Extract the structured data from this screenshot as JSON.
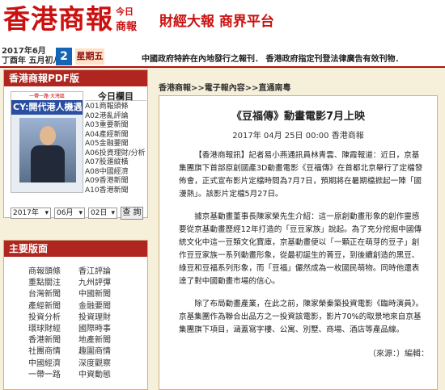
{
  "header": {
    "logo": "香港商報",
    "logo_sub_top": "今日",
    "logo_sub_bottom": "商報",
    "slogan": "財經大報 商界平台"
  },
  "datebar": {
    "date_line1": "2017年6月",
    "date_line2": "丁酉年 五月初八",
    "day": "2",
    "weekday": "星期五",
    "ticker": "中國政府特許在內地發行之報刊． 香港政府指定刊登法律廣告有效刊物．"
  },
  "pdf": {
    "heading": "香港商報PDF版",
    "thumb_bar": "一帶一路‧大灣區",
    "thumb_caption": "CY:開代港人機遇",
    "list_title": "今日欄目",
    "items": [
      "A01商報頭條",
      "A02港亂評論",
      "A03重要新聞",
      "A04產經新聞",
      "A05金融要聞",
      "A06投資理財/分析",
      "A07股滙縱橫",
      "A08中國經濟",
      "A09香港新聞",
      "A10香港新聞"
    ],
    "year": "2017年",
    "month": "06月",
    "day": "02日",
    "query_label": "查 詢"
  },
  "sections": {
    "heading": "主要版面",
    "rows": [
      [
        "商報頭條",
        "香江評論"
      ],
      [
        "重點關注",
        "九州評彈"
      ],
      [
        "台灣新聞",
        "中國新聞"
      ],
      [
        "產經新聞",
        "金融要聞"
      ],
      [
        "投資分析",
        "投資理財"
      ],
      [
        "環球財經",
        "國際時事"
      ],
      [
        "香港新聞",
        "地產新聞"
      ],
      [
        "社團商情",
        "趣圍商情"
      ],
      [
        "中國經濟",
        "深度觀察"
      ],
      [
        "一帶一路",
        "中資動態"
      ]
    ]
  },
  "breadcrumb": "香港商報>>電子報內容>>直通南粵",
  "article": {
    "title": "《豆福傳》動畫電影7月上映",
    "meta": "2017年 04月 25日 00:00 香港商報",
    "paragraphs": [
      "【香港商報訊】記者易小燕通訊員林青雲、陳霞報道：近日，京基集團旗下首部原創國產3D動畫電影《豆福傳》在首都北京舉行了定檔發佈會，正式宣布影片定檔時間為7月7日，預期將在暑期檔掀起一陣「國漫熱」。該影片定檔5月27日。",
      "據京基動畫董事長陳家榮先生介紹：這一原創動畫形象的創作靈感要從京基動畫歷經12年打造的「豆豆家族」說起。為了充分挖掘中國傳統文化中這一豆類文化寶庫，京基動畫便以「一顆正在萌芽的豆子」創作豆豆家族一系列動畫形象，從最初誕生的菁豆，到後續創造的黑豆、綠豆和豆福系列形象，而「豆福」儼然成為一枚國民萌物。同時他還表達了對中國動畫市場的信心。",
      "除了布局動畫產業，在此之前，陳家榮秦築投資電影《臨時演員》。京基集團作為聯合出品方之一投資該電影，影片70%的取景地來自京基集團旗下項目，涵蓋寫字樓、公寓、別墅、商場、酒店等產品線。"
    ],
    "source": "（來源：）編輯："
  }
}
